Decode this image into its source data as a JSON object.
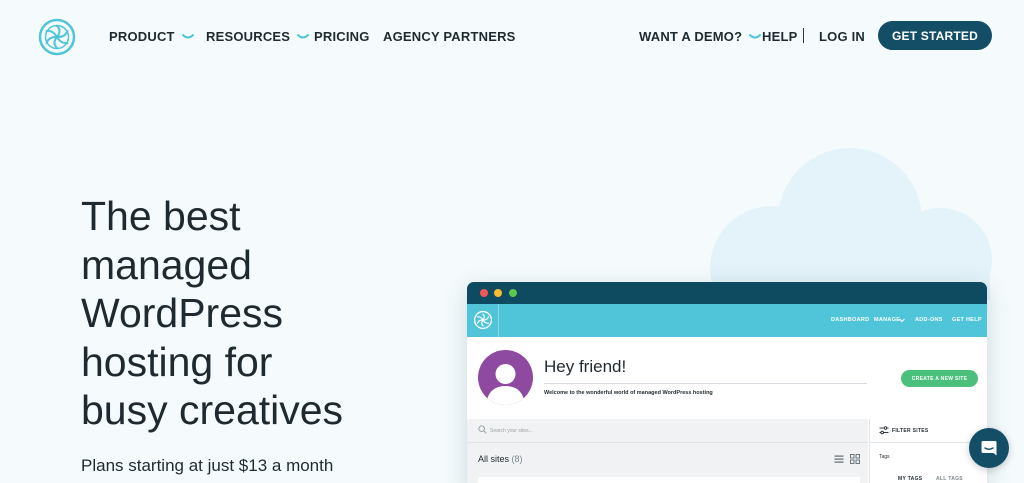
{
  "nav": {
    "items": [
      {
        "label": "PRODUCT",
        "has_dropdown": true
      },
      {
        "label": "RESOURCES",
        "has_dropdown": true
      },
      {
        "label": "PRICING",
        "has_dropdown": false
      },
      {
        "label": "AGENCY PARTNERS",
        "has_dropdown": false
      }
    ],
    "right_items": [
      {
        "label": "WANT A DEMO?",
        "has_dropdown": true
      },
      {
        "label": "HELP",
        "has_dropdown": false
      },
      {
        "label": "LOG IN",
        "has_dropdown": false
      }
    ],
    "cta_label": "GET STARTED"
  },
  "hero": {
    "headline": [
      "The best",
      "managed",
      "WordPress",
      "hosting for",
      "busy creatives"
    ],
    "subline": "Plans starting at just $13 a month"
  },
  "app": {
    "nav": [
      "DASHBOARD",
      "MANAGE",
      "ADD-ONS",
      "GET HELP"
    ],
    "greeting": "Hey friend!",
    "welcome": "Welcome to the wonderful world of managed WordPress hosting",
    "create_button": "CREATE A NEW SITE",
    "search_placeholder": "Search your sites...",
    "all_sites_label": "All sites",
    "all_sites_count": "(8)",
    "filter_label": "FILTER SITES",
    "tags_label": "Tags",
    "tag_tabs": [
      "MY TAGS",
      "ALL TAGS"
    ]
  },
  "colors": {
    "brand_dark": "#134e66",
    "brand_teal": "#50c4d8",
    "accent_green": "#4bc07c",
    "avatar_purple": "#8e4aa0",
    "background": "#f5fbfd"
  },
  "icons": {
    "logo": "flywheel-logo-icon",
    "dropdown": "chevron-down-icon",
    "chat": "chat-bubble-icon",
    "search": "search-icon",
    "filter": "filter-icon",
    "list_view": "list-view-icon",
    "grid_view": "grid-view-icon"
  }
}
